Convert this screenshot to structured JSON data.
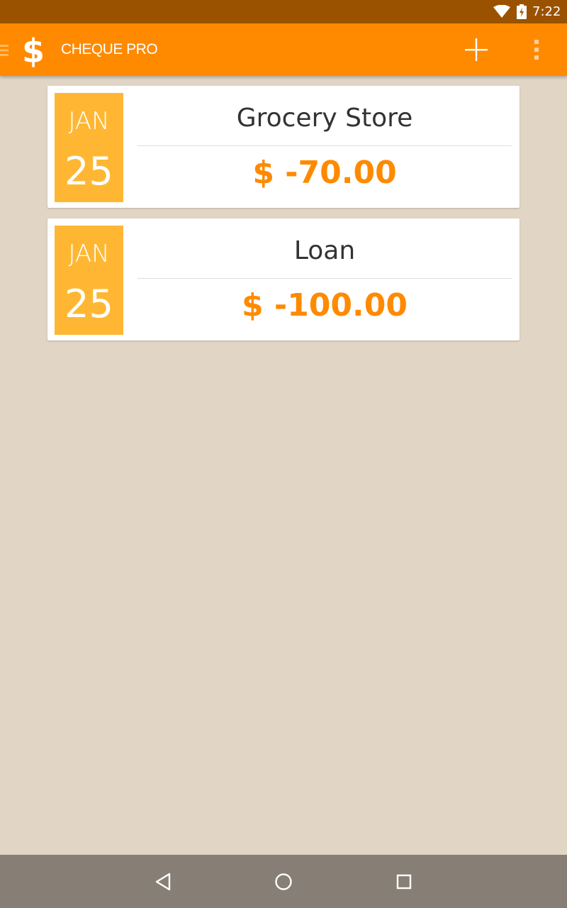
{
  "status_bar": {
    "time": "7:22",
    "wifi_icon": "wifi-icon",
    "battery_icon": "battery-charging-icon"
  },
  "app_bar": {
    "title": "CHEQUE PRO",
    "logo_icon": "dollar-sign-icon",
    "menu_icon": "menu-icon",
    "add_icon": "plus-icon",
    "more_icon": "more-vertical-icon",
    "background_color": "#ff8a00"
  },
  "transactions": [
    {
      "month": "JAN",
      "day": "25",
      "payee": "Grocery Store",
      "amount": "$ -70.00"
    },
    {
      "month": "JAN",
      "day": "25",
      "payee": "Loan",
      "amount": "$ -100.00"
    }
  ],
  "colors": {
    "accent": "#ff8a00",
    "date_badge": "#ffb733",
    "status_bar": "#9a5200",
    "background": "#e1d5c5",
    "nav_bar": "#877f75"
  },
  "nav_bar": {
    "back_icon": "back-icon",
    "home_icon": "home-icon",
    "recents_icon": "recents-icon"
  }
}
